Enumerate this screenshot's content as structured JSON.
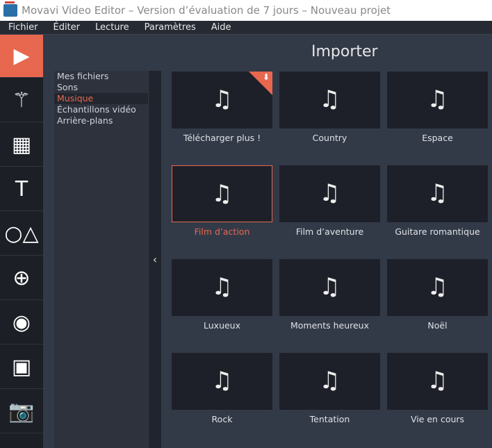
{
  "window": {
    "title": "Movavi Video Editor – Version d’évaluation de 7 jours – Nouveau projet"
  },
  "menu": [
    "Fichier",
    "Éditer",
    "Lecture",
    "Paramètres",
    "Aide"
  ],
  "tools": [
    {
      "icon": "import-icon",
      "glyph": "▶"
    },
    {
      "icon": "magic-wand-icon",
      "glyph": "⚚"
    },
    {
      "icon": "transitions-icon",
      "glyph": "▦"
    },
    {
      "icon": "text-icon",
      "glyph": "T"
    },
    {
      "icon": "shapes-icon",
      "glyph": "○△"
    },
    {
      "icon": "zoom-pan-icon",
      "glyph": "⊕"
    },
    {
      "icon": "mask-icon",
      "glyph": "◉"
    },
    {
      "icon": "overlay-icon",
      "glyph": "▣"
    },
    {
      "icon": "camera-icon",
      "glyph": "📷"
    }
  ],
  "panel": {
    "heading": "Importer"
  },
  "categories": [
    {
      "label": "Mes fichiers"
    },
    {
      "label": "Sons"
    },
    {
      "label": "Musique",
      "selected": true
    },
    {
      "label": "Échantillons vidéo"
    },
    {
      "label": "Arrière-plans"
    }
  ],
  "collapse_glyph": "‹",
  "tiles": [
    {
      "label": "Télécharger plus !",
      "download": true
    },
    {
      "label": "Country"
    },
    {
      "label": "Espace"
    },
    {
      "label": "Film d’action",
      "selected": true
    },
    {
      "label": "Film d’aventure"
    },
    {
      "label": "Guitare romantique"
    },
    {
      "label": "Luxueux"
    },
    {
      "label": "Moments heureux"
    },
    {
      "label": "Noël"
    },
    {
      "label": "Rock"
    },
    {
      "label": "Tentation"
    },
    {
      "label": "Vie en cours"
    }
  ],
  "colors": {
    "accent": "#e8674f"
  }
}
